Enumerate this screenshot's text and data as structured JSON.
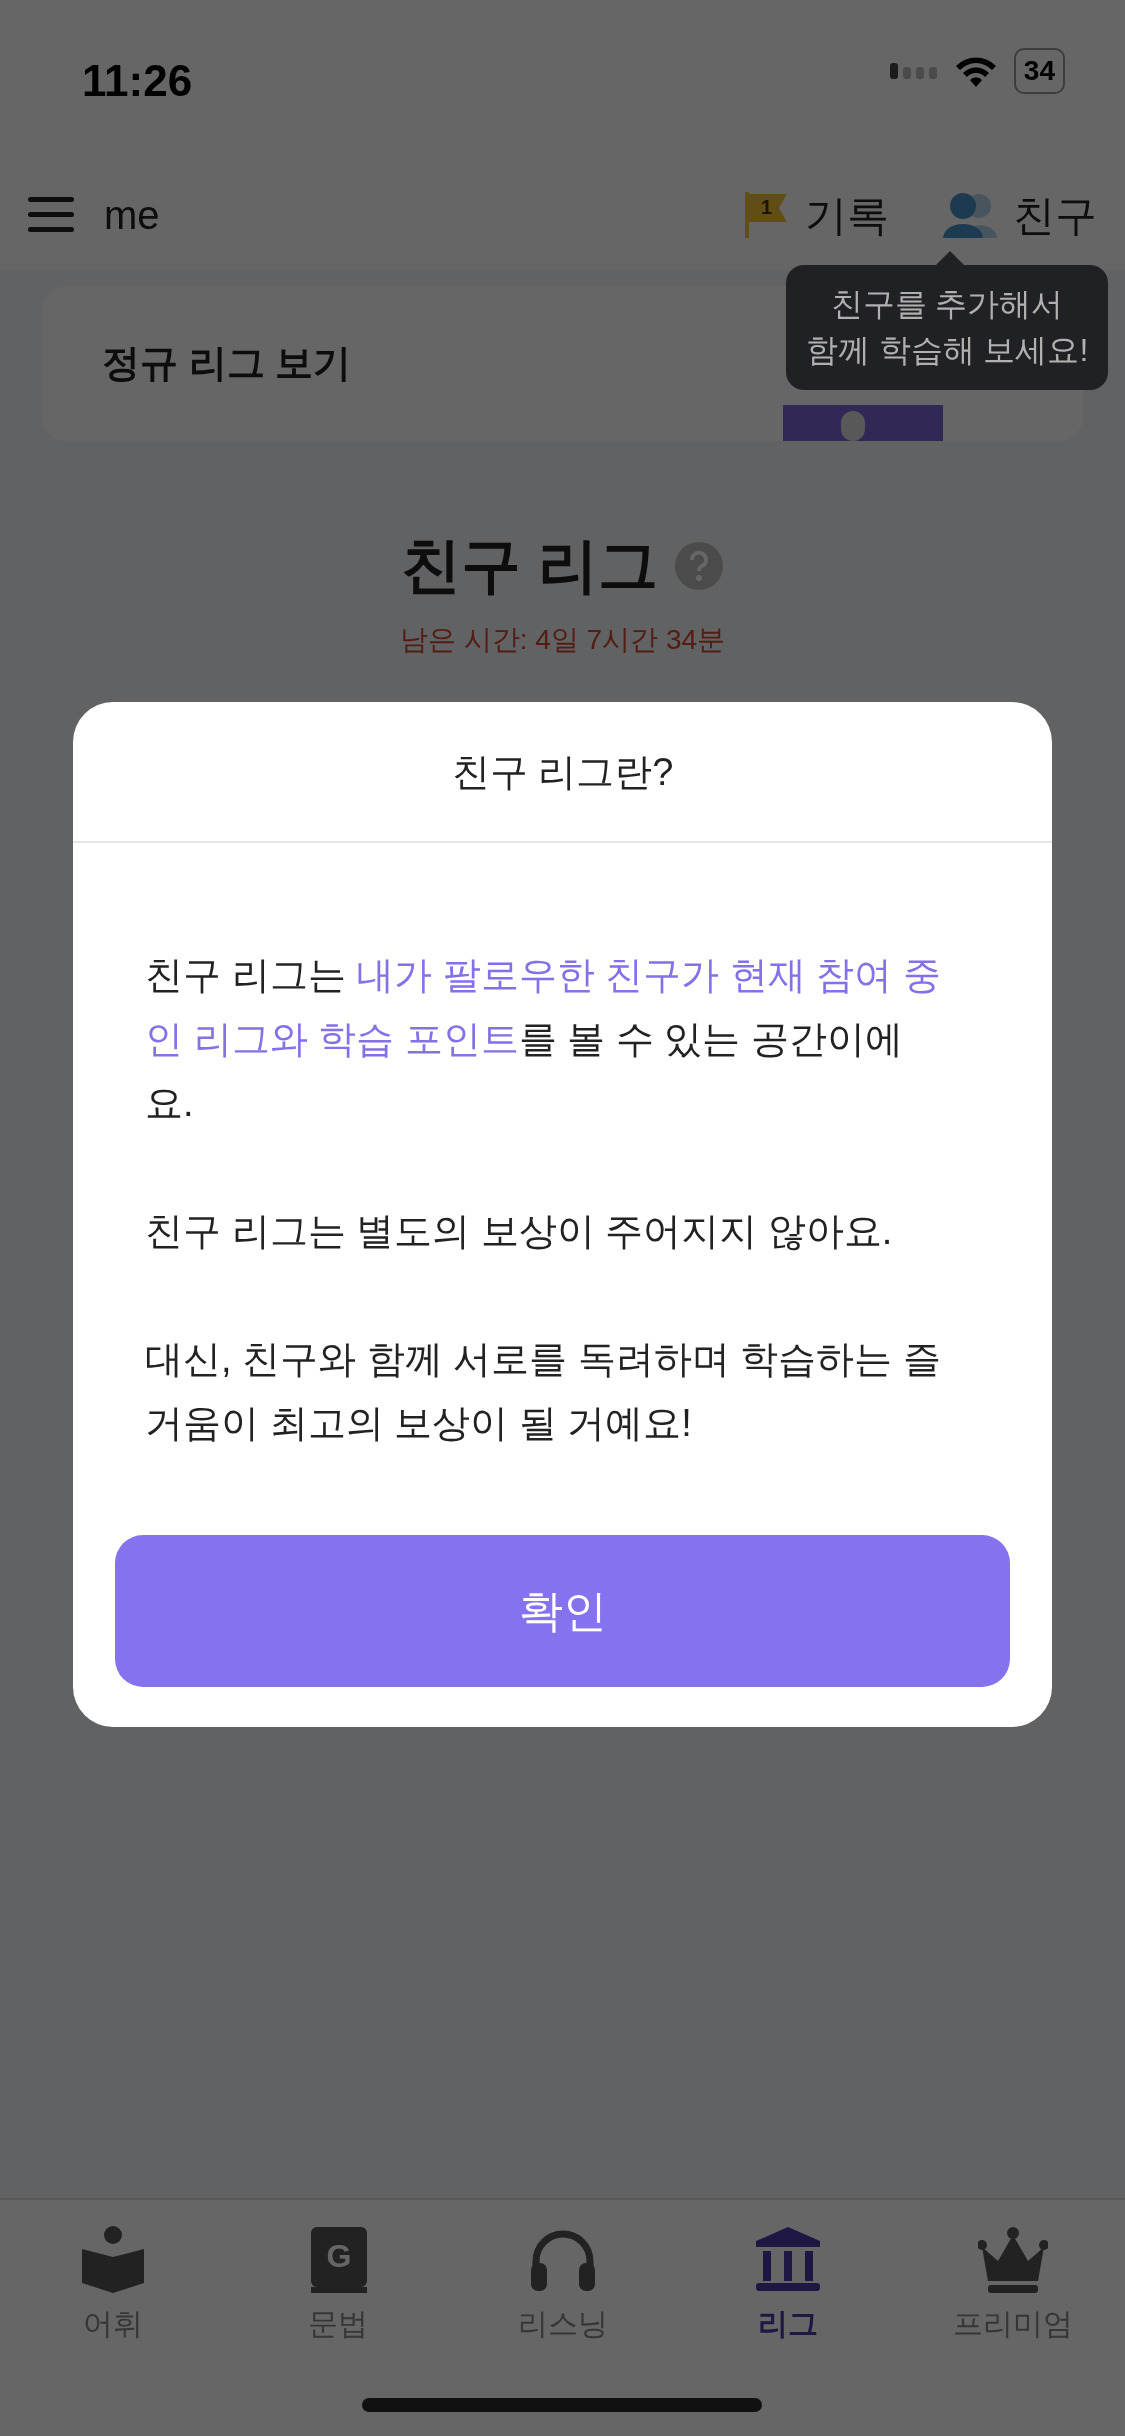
{
  "status_bar": {
    "time": "11:26",
    "battery": "34"
  },
  "header": {
    "title": "me",
    "actions": [
      {
        "kind": "flag",
        "label": "기록",
        "badge": "1"
      },
      {
        "kind": "friends",
        "label": "친구"
      }
    ]
  },
  "tooltip": {
    "lines": [
      "친구를 추가해서",
      "함께 학습해 보세요!"
    ]
  },
  "regular_league_card": {
    "label": "정규 리그 보기"
  },
  "league": {
    "title": "친구 리그",
    "remaining": "남은 시간: 4일 7시간 34분"
  },
  "modal": {
    "title": "친구 리그란?",
    "paragraphs": [
      [
        {
          "text": "친구 리그는 ",
          "highlight": false
        },
        {
          "text": "내가 팔로우한 친구가 현재 참여 중인 리그와 학습 포인트",
          "highlight": true
        },
        {
          "text": "를 볼 수 있는 공간이에요.",
          "highlight": false
        }
      ],
      [
        {
          "text": "친구 리그는 별도의 보상이 주어지지 않아요.",
          "highlight": false
        }
      ],
      [
        {
          "text": "대신, 친구와 함께 서로를 독려하며 학습하는 즐거움이 최고의 보상이 될 거예요!",
          "highlight": false
        }
      ]
    ],
    "button": "확인"
  },
  "tab_bar": [
    {
      "kind": "vocab",
      "label": "어휘",
      "selected": false
    },
    {
      "kind": "grammar",
      "label": "문법",
      "icon_letter": "G",
      "selected": false
    },
    {
      "kind": "listening",
      "label": "리스닝",
      "selected": false
    },
    {
      "kind": "league",
      "label": "리그",
      "selected": true
    },
    {
      "kind": "premium",
      "label": "프리미엄",
      "selected": false
    }
  ]
}
